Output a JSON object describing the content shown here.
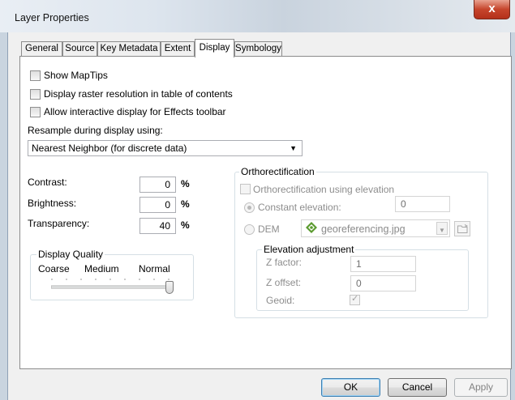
{
  "window": {
    "title": "Layer Properties",
    "close_glyph": "x"
  },
  "tabs": [
    {
      "label": "General"
    },
    {
      "label": "Source"
    },
    {
      "label": "Key Metadata"
    },
    {
      "label": "Extent"
    },
    {
      "label": "Display",
      "active": true
    },
    {
      "label": "Symbology"
    }
  ],
  "display": {
    "checkboxes": {
      "show_maptips": {
        "label": "Show MapTips",
        "checked": false
      },
      "raster_resolution": {
        "label": "Display raster resolution in table of contents",
        "checked": false
      },
      "effects_toolbar": {
        "label": "Allow interactive display for Effects toolbar",
        "checked": false
      }
    },
    "resample": {
      "label": "Resample during display using:",
      "selected": "Nearest Neighbor (for discrete data)"
    },
    "contrast": {
      "label": "Contrast:",
      "value": "0",
      "unit": "%"
    },
    "brightness": {
      "label": "Brightness:",
      "value": "0",
      "unit": "%"
    },
    "transparency": {
      "label": "Transparency:",
      "value": "40",
      "unit": "%"
    },
    "quality": {
      "legend": "Display Quality",
      "coarse": "Coarse",
      "medium": "Medium",
      "normal": "Normal",
      "level": 1.0
    },
    "ortho": {
      "legend": "Orthorectification",
      "using_elevation": {
        "label": "Orthorectification using elevation",
        "checked": false
      },
      "constant_elevation": {
        "label": "Constant elevation:",
        "value": "0",
        "selected": true
      },
      "dem": {
        "label": "DEM",
        "file": "georeferencing.jpg",
        "selected": false
      },
      "adjustment": {
        "legend": "Elevation adjustment",
        "z_factor": {
          "label": "Z factor:",
          "value": "1"
        },
        "z_offset": {
          "label": "Z offset:",
          "value": "0"
        },
        "geoid": {
          "label": "Geoid:",
          "checked": true
        }
      }
    }
  },
  "buttons": {
    "ok": "OK",
    "cancel": "Cancel",
    "apply": "Apply"
  },
  "colors": {
    "close_button": "#c6452c",
    "default_button_border": "#3c7fb1",
    "accent_green": "#5a9a2e"
  }
}
